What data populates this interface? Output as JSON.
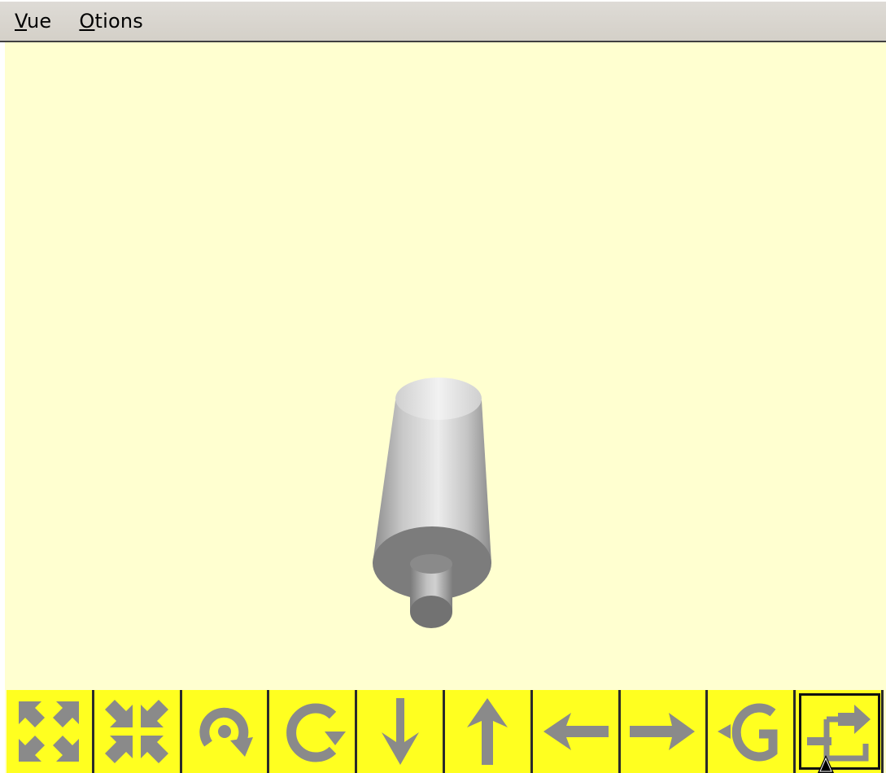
{
  "menubar": {
    "items": [
      {
        "mnemonic": "V",
        "rest": "ue"
      },
      {
        "mnemonic": "O",
        "rest": "tions"
      }
    ]
  },
  "viewport": {
    "background": "#ffffd0",
    "object": "cylinder-shaft"
  },
  "toolbar": {
    "buttons": [
      {
        "icon": "expand-arrows-icon",
        "active": false
      },
      {
        "icon": "contract-arrows-icon",
        "active": false
      },
      {
        "icon": "rotate-cw-icon",
        "active": false
      },
      {
        "icon": "rotate-ccw-icon",
        "active": false
      },
      {
        "icon": "arrow-down-icon",
        "active": false
      },
      {
        "icon": "arrow-up-icon",
        "active": false
      },
      {
        "icon": "arrow-left-icon",
        "active": false
      },
      {
        "icon": "arrow-right-icon",
        "active": false
      },
      {
        "icon": "undo-arrow-icon",
        "active": false
      },
      {
        "icon": "exit-icon",
        "active": true
      }
    ],
    "button_color": "#ffff20",
    "icon_color": "#8a8a8a"
  }
}
